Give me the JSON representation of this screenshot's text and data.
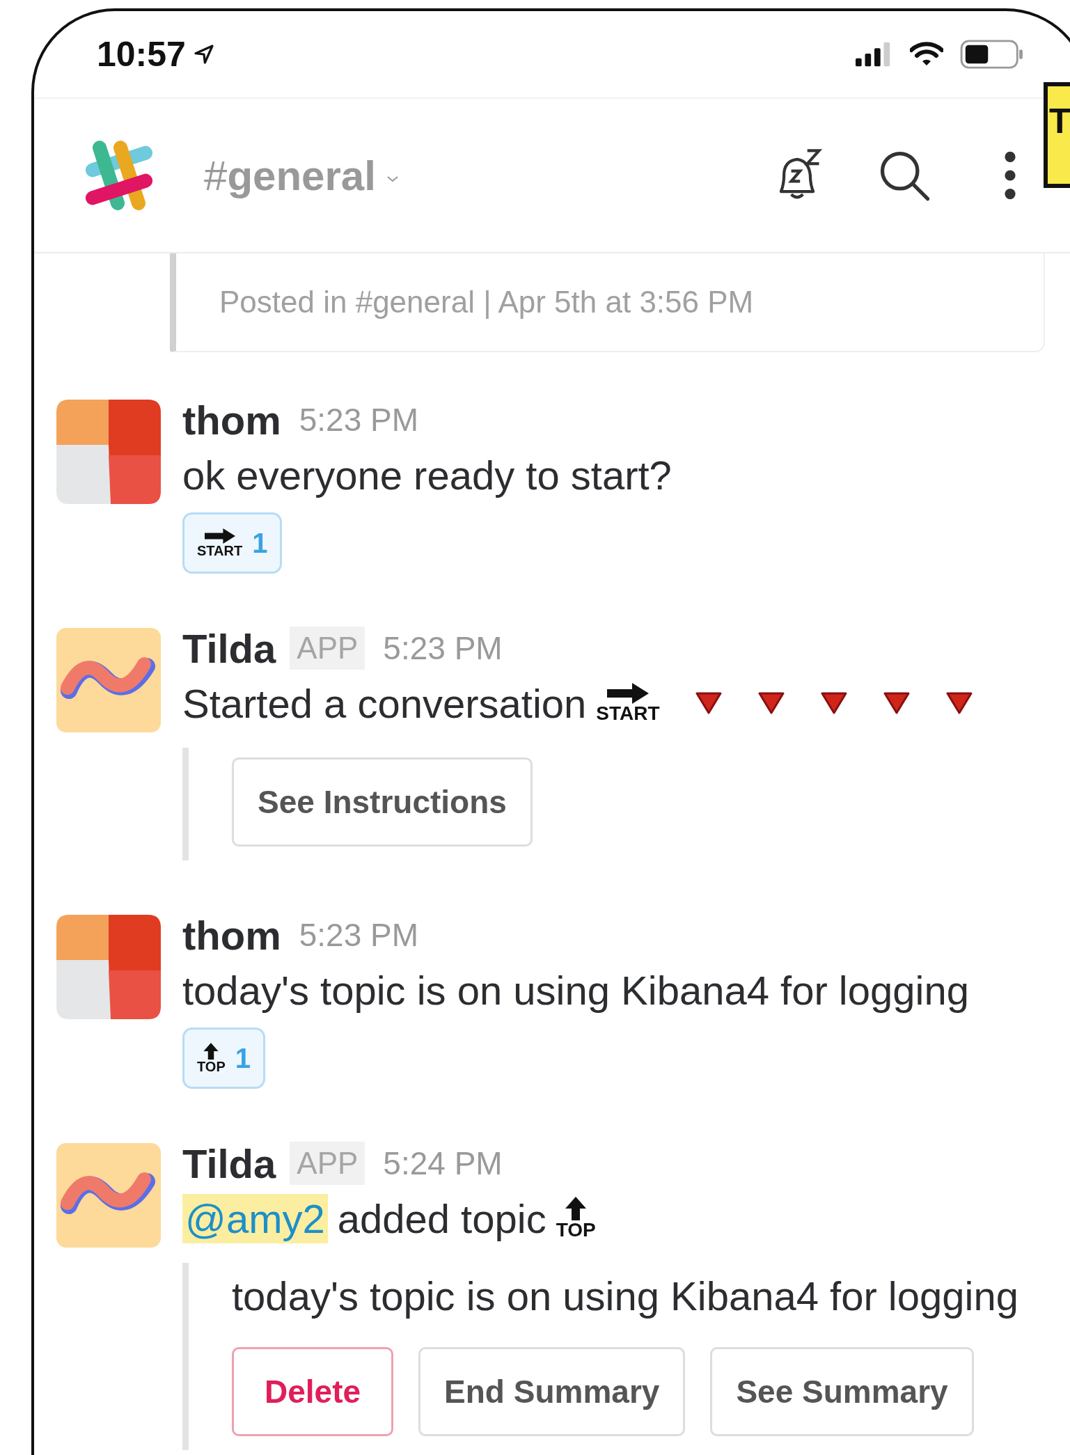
{
  "status_bar": {
    "time": "10:57"
  },
  "overlay_tag": {
    "text": "T"
  },
  "header": {
    "channel": "#**general**"
  },
  "posted_card": {
    "text": "Posted in #general | Apr 5th at 3:56 PM"
  },
  "messages": [
    {
      "kind": "user",
      "author": "thom",
      "time": "5:23 PM",
      "body": [
        {
          "kind": "text",
          "text": "ok everyone ready to start?"
        }
      ],
      "reactions": [
        {
          "kind": "start",
          "label": "START",
          "count": "1"
        }
      ]
    },
    {
      "kind": "app",
      "author": "Tilda",
      "badge": "APP",
      "time": "5:23 PM",
      "body": [
        {
          "kind": "text",
          "text": "Started a conversation"
        },
        {
          "kind": "start",
          "label": "START"
        },
        {
          "kind": "triangle"
        },
        {
          "kind": "triangle"
        },
        {
          "kind": "triangle"
        },
        {
          "kind": "triangle"
        },
        {
          "kind": "triangle"
        }
      ],
      "attachment": {
        "buttons": [
          {
            "kind": "default",
            "label": "See Instructions"
          }
        ]
      }
    },
    {
      "kind": "user",
      "author": "thom",
      "time": "5:23 PM",
      "body": [
        {
          "kind": "text",
          "text": "today's topic is on using Kibana4 for logging"
        }
      ],
      "reactions": [
        {
          "kind": "top",
          "label": "TOP",
          "count": "1"
        }
      ]
    },
    {
      "kind": "app",
      "author": "Tilda",
      "badge": "APP",
      "time": "5:24 PM",
      "body": [
        {
          "kind": "mention",
          "text": "@amy2"
        },
        {
          "kind": "text",
          "text": "added topic"
        },
        {
          "kind": "top",
          "label": "TOP"
        }
      ],
      "attachment": {
        "text": "today's topic is on using Kibana4 for logging",
        "buttons": [
          {
            "kind": "danger",
            "label": "Delete"
          },
          {
            "kind": "default",
            "label": "End Summary"
          },
          {
            "kind": "default",
            "label": "See Summary"
          }
        ]
      }
    }
  ]
}
